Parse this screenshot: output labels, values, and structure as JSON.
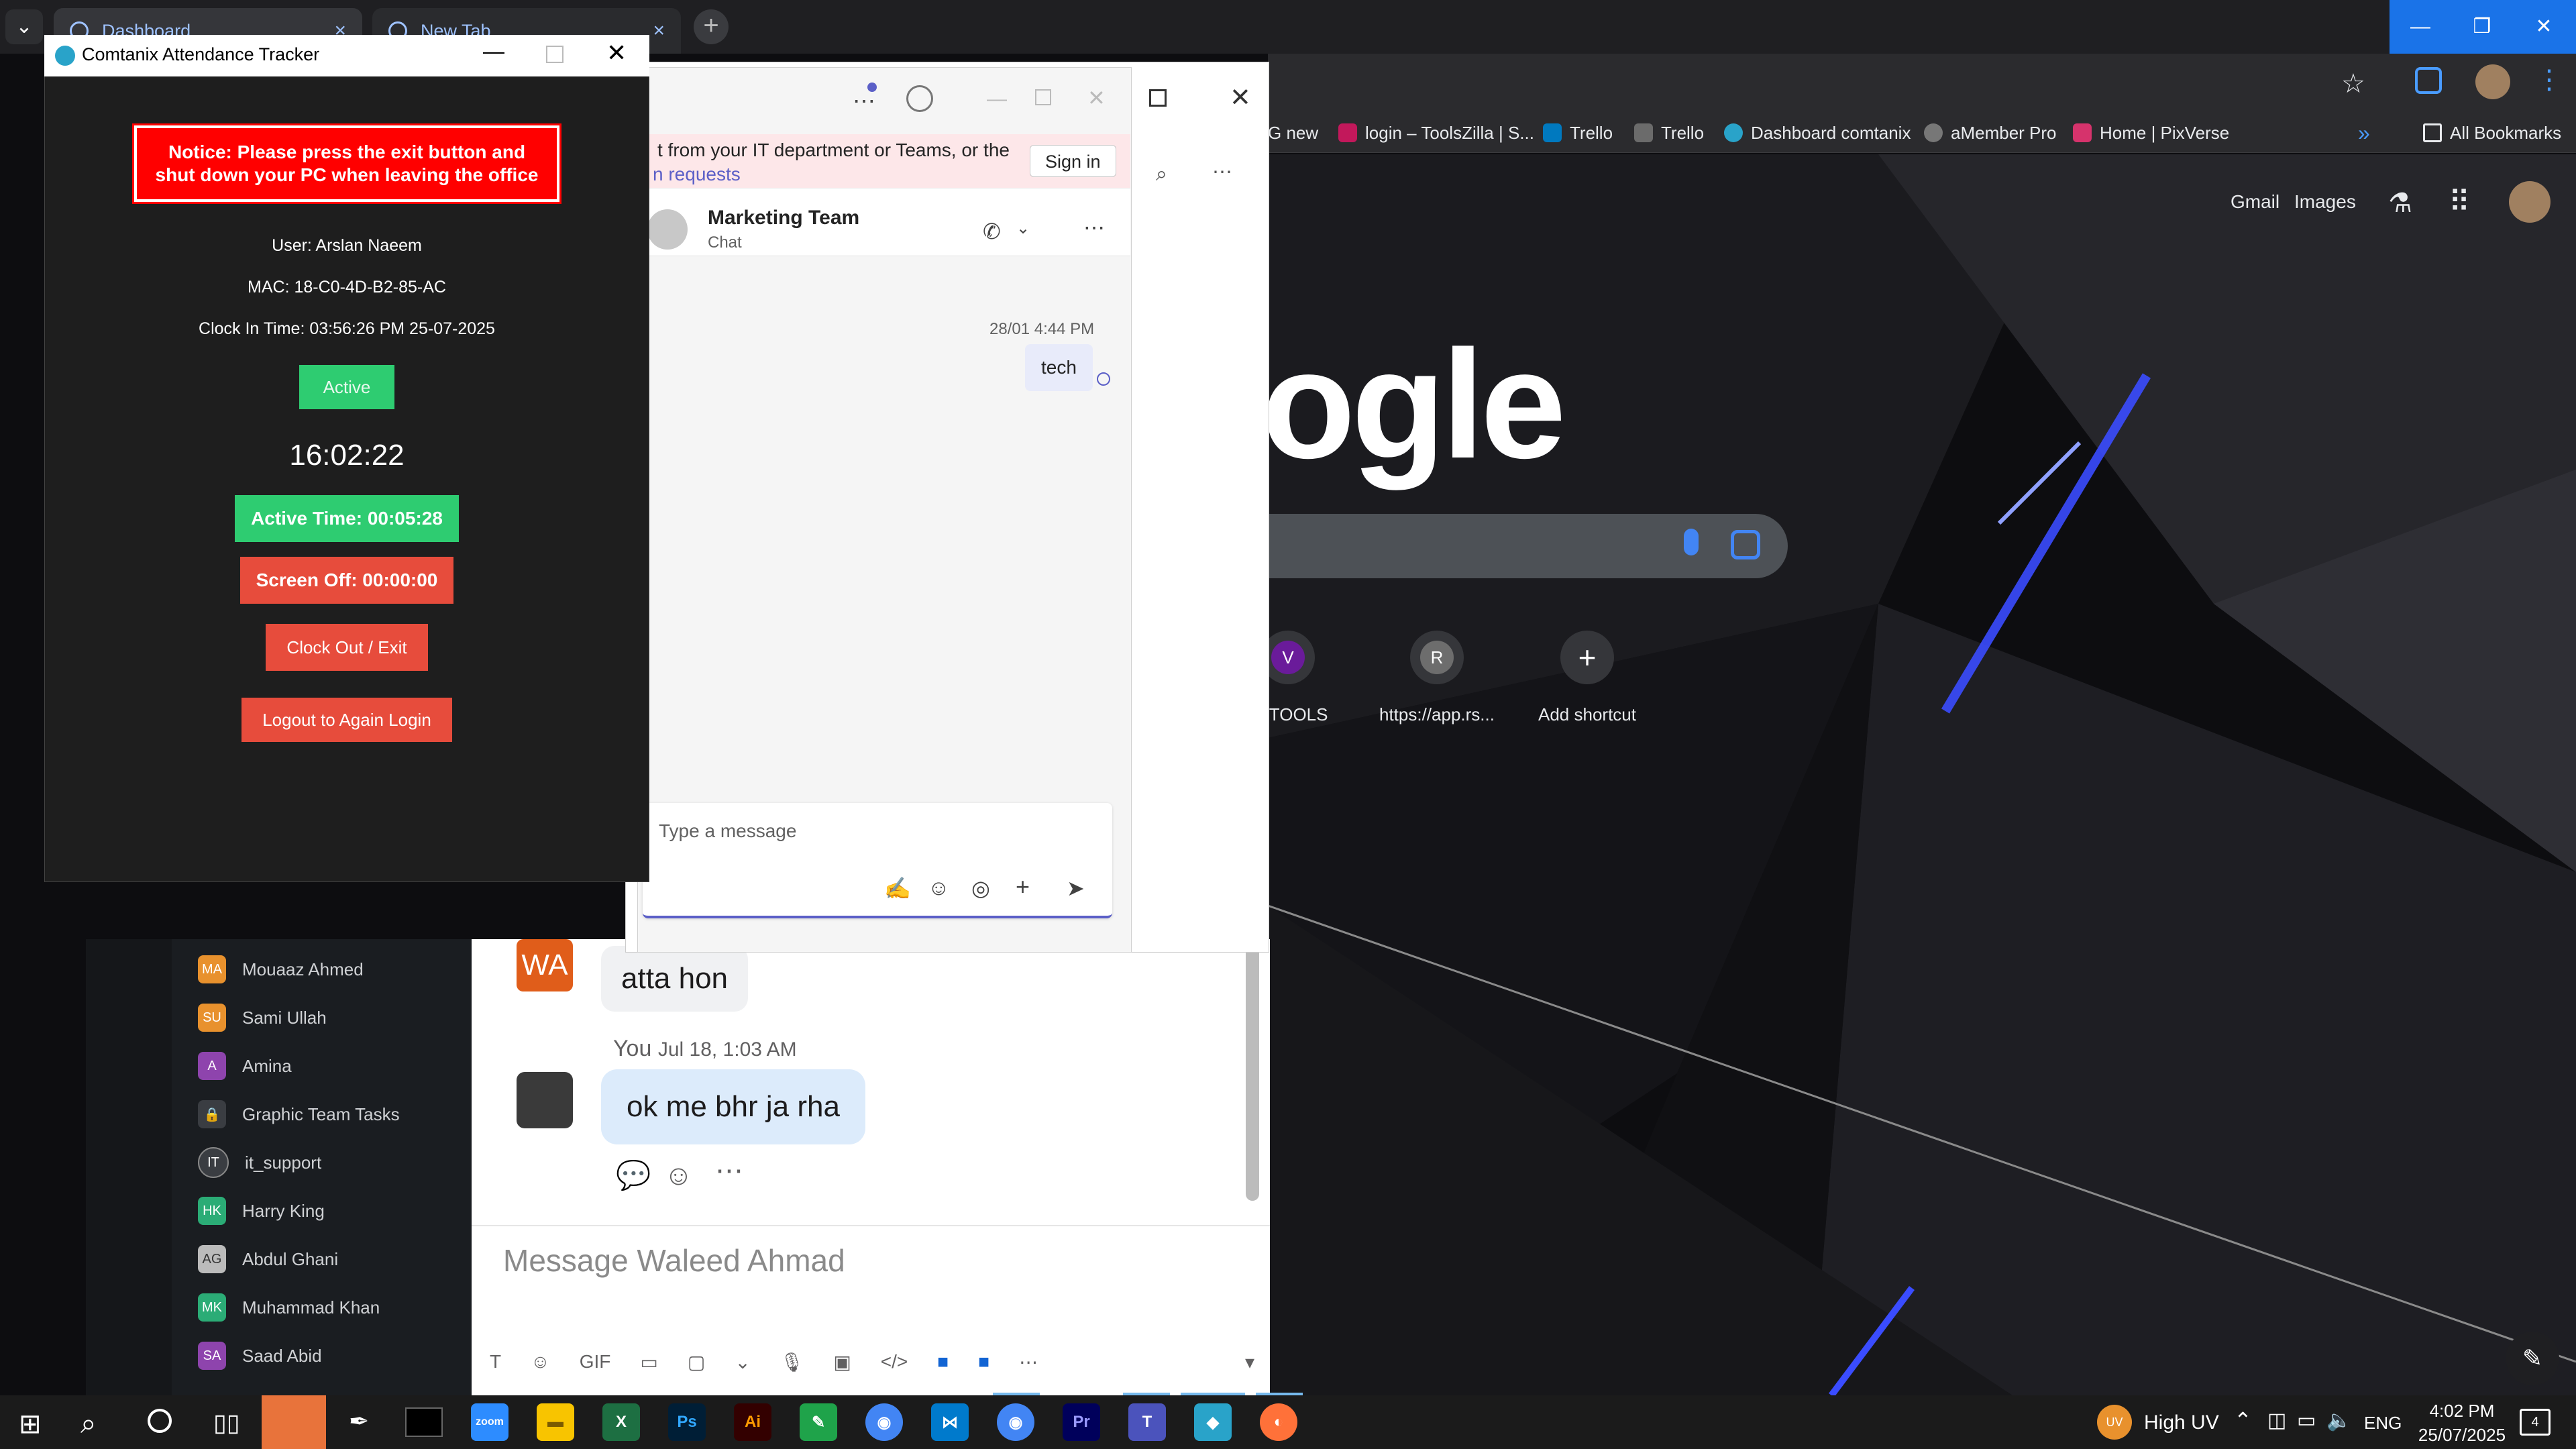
{
  "chrome": {
    "tabs": [
      {
        "label": "Dashboard",
        "close": "×"
      },
      {
        "label": "New Tab",
        "close": "×"
      }
    ],
    "new_tab": "+",
    "tab_search": "⌄",
    "window_controls": {
      "minimize": "—",
      "restore": "❐",
      "close": "✕"
    },
    "bookmarks": [
      "G new",
      "login – ToolsZilla | S...",
      "Trello",
      "Trello",
      "Dashboard comtanix",
      "aMember Pro",
      "Home | PixVerse"
    ],
    "bookmarks_overflow": "»",
    "all_bookmarks": "All Bookmarks",
    "google": {
      "top_links": [
        "Gmail",
        "Images"
      ],
      "logo_fragment": "ogle",
      "shortcuts": [
        {
          "letter": "V",
          "label": "W TOOLS"
        },
        {
          "letter": "R",
          "label": "https://app.rs..."
        },
        {
          "letter": "+",
          "label": "Add shortcut"
        }
      ],
      "edit": "✎"
    }
  },
  "slack": {
    "messages": [
      {
        "avatar": "WA",
        "text": "atta hon"
      },
      {
        "author": "You",
        "time": "Jul 18, 1:03 AM",
        "text": "ok me bhr ja rha"
      }
    ],
    "message_placeholder": "Message Waleed Ahmad",
    "dm_list": [
      {
        "initials": "MA",
        "name": "Mouaaz Ahmed",
        "color": "#e8912d"
      },
      {
        "initials": "SU",
        "name": "Sami Ullah",
        "color": "#e8912d"
      },
      {
        "initials": "A",
        "name": "Amina",
        "color": "#8e44ad"
      },
      {
        "initials": "🔒",
        "name": "Graphic Team Tasks",
        "color": "#3a3d42"
      },
      {
        "initials": "IT",
        "name": "it_support",
        "color": "#3a3d42"
      },
      {
        "initials": "HK",
        "name": "Harry King",
        "color": "#2bac76"
      },
      {
        "initials": "AG",
        "name": "Abdul Ghani",
        "color": "#bbbbbb"
      },
      {
        "initials": "MK",
        "name": "Muhammad Khan",
        "color": "#2bac76"
      },
      {
        "initials": "SA",
        "name": "Saad Abid",
        "color": "#8e44ad"
      }
    ],
    "composer_tools": [
      "T",
      "☺",
      "GIF",
      "▭",
      "▢",
      "⌄",
      "🎙",
      "▣",
      "</>",
      "■",
      "■",
      "⋯"
    ]
  },
  "teams": {
    "banner_text_1": "t from your IT department or Teams, or the",
    "banner_text_2": "n requests",
    "sign_in": "Sign in",
    "chat_name": "Marketing Team",
    "chat_sub": "Chat",
    "message_time": "28/01 4:44 PM",
    "message_text": "tech",
    "compose_placeholder": "Type a message",
    "more": "⋯"
  },
  "tracker": {
    "title": "Comtanix Attendance Tracker",
    "notice": "Notice: Please press the exit button and shut down your PC when leaving the office",
    "user": "User: Arslan  Naeem",
    "mac": "MAC: 18-C0-4D-B2-85-AC",
    "clock_in": "Clock In Time: 03:56:26 PM 25-07-2025",
    "status": "Active",
    "clock": "16:02:22",
    "active_time": "Active Time: 00:05:28",
    "screen_off": "Screen Off: 00:00:00",
    "clock_out": "Clock Out / Exit",
    "logout": "Logout to Again Login",
    "colors": {
      "green": "#2ecc71",
      "red": "#e74c3c"
    }
  },
  "taskbar": {
    "weather": "High UV",
    "weather_badge": "UV",
    "language": "ENG",
    "time": "4:02 PM",
    "date": "25/07/2025",
    "notification_count": "4",
    "apps": [
      {
        "label": "zoom",
        "color": "#2d8cff"
      },
      {
        "label": "▬",
        "color": "#f8c400"
      },
      {
        "label": "X",
        "color": "#1d6f42"
      },
      {
        "label": "Ps",
        "color": "#001e36"
      },
      {
        "label": "Ai",
        "color": "#330000"
      },
      {
        "label": "✎",
        "color": "#1fa34a"
      },
      {
        "label": "◉",
        "color": "#4285f4"
      },
      {
        "label": "⋈",
        "color": "#007acc"
      },
      {
        "label": "◉",
        "color": "#4285f4"
      },
      {
        "label": "Pr",
        "color": "#00005b"
      },
      {
        "label": "T",
        "color": "#4b53bc"
      },
      {
        "label": "◆",
        "color": "#29a3c9"
      },
      {
        "label": "◐",
        "color": "#ff7139"
      }
    ]
  }
}
